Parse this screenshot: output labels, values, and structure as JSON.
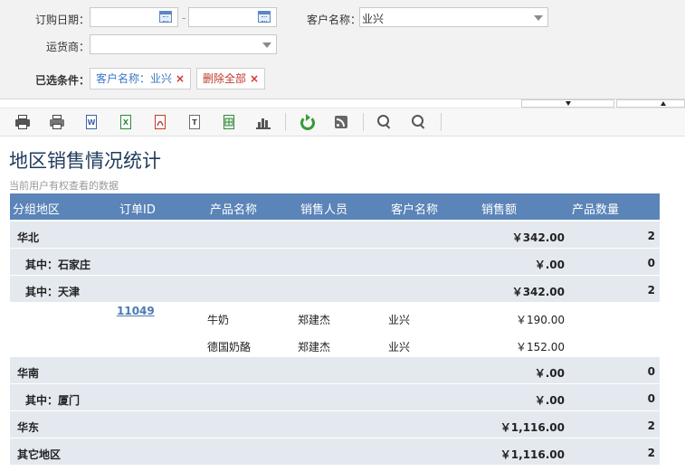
{
  "filters": {
    "order_date_label": "订购日期：",
    "date_from_value": "",
    "date_to_value": "",
    "date_separator": "-",
    "customer_label": "客户名称：",
    "customer_value": "业兴",
    "shipper_label": "运货商：",
    "shipper_value": "",
    "selected_label": "已选条件：",
    "chips": [
      {
        "text": "客户名称：业兴",
        "remove": "×"
      },
      {
        "text": "删除全部",
        "remove": "×"
      }
    ]
  },
  "toolbar": {
    "icons": [
      "print-icon",
      "print-preview-icon",
      "export-word-icon",
      "export-excel-icon",
      "export-pdf-icon",
      "export-text-icon",
      "export-image-icon",
      "chart-icon",
      "refresh-icon",
      "rss-icon",
      "zoom-in-icon",
      "zoom-out-icon"
    ],
    "word_letter": "W",
    "excel_letter": "X",
    "text_letter": "T"
  },
  "report": {
    "title": "地区销售情况统计",
    "subtitle": "当前用户有权查看的数据",
    "columns": [
      "分组地区",
      "订单ID",
      "产品名称",
      "销售人员",
      "客户名称",
      "销售额",
      "产品数量"
    ],
    "rows": [
      {
        "type": "group",
        "region": "华北",
        "amount": "￥342.00",
        "qty": "2"
      },
      {
        "type": "group",
        "region": "其中：石家庄",
        "amount": "￥.00",
        "qty": "0"
      },
      {
        "type": "group",
        "region": "其中：天津",
        "amount": "￥342.00",
        "qty": "2"
      },
      {
        "type": "detail",
        "order_id": "11049",
        "product": "牛奶",
        "sales": "郑建杰",
        "customer": "业兴",
        "amount": "￥190.00"
      },
      {
        "type": "detail",
        "order_id": "",
        "product": "德国奶酪",
        "sales": "郑建杰",
        "customer": "业兴",
        "amount": "￥152.00"
      },
      {
        "type": "group",
        "region": "华南",
        "amount": "￥.00",
        "qty": "0"
      },
      {
        "type": "group",
        "region": "其中：厦门",
        "amount": "￥.00",
        "qty": "0"
      },
      {
        "type": "group",
        "region": "华东",
        "amount": "￥1,116.00",
        "qty": "2"
      },
      {
        "type": "group",
        "region": "其它地区",
        "amount": "￥1,116.00",
        "qty": "2"
      }
    ]
  },
  "colors": {
    "header_bg": "#5b84b8",
    "group_row_bg": "#e4e9f0",
    "link": "#4a7ab5",
    "title": "#1f3a5c"
  }
}
